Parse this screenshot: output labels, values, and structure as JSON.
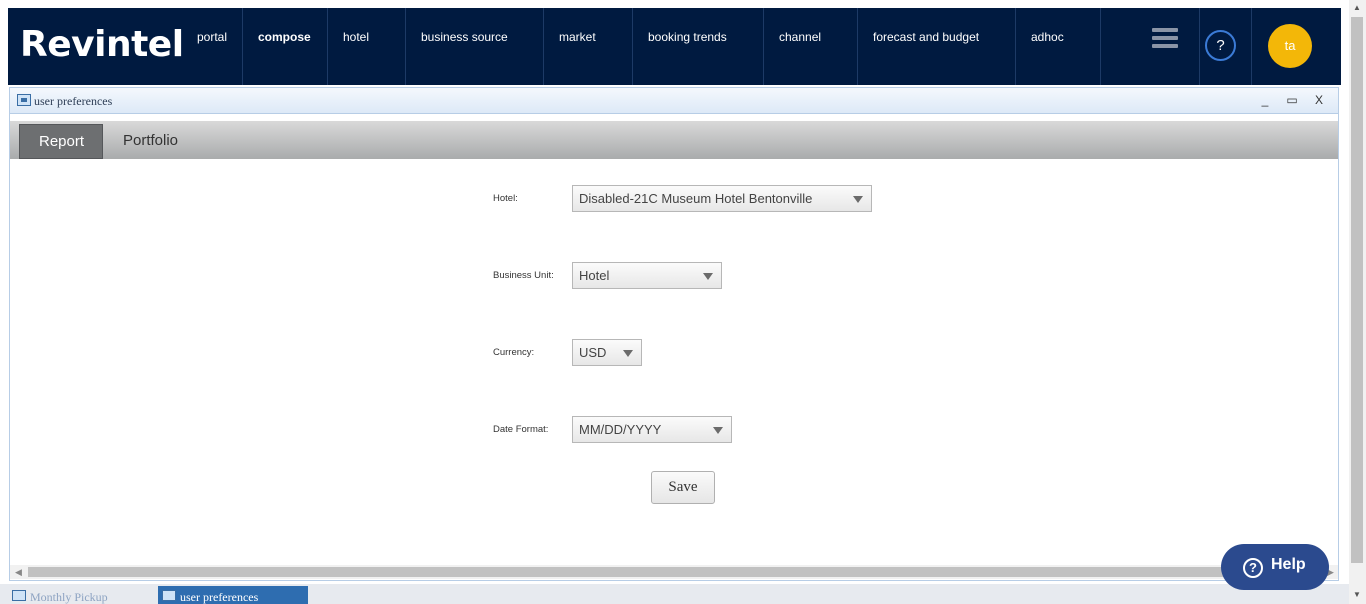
{
  "app": {
    "logo": "Revintel"
  },
  "nav": {
    "items": [
      {
        "label": "portal"
      },
      {
        "label": "compose"
      },
      {
        "label": "hotel"
      },
      {
        "label": "business source"
      },
      {
        "label": "market"
      },
      {
        "label": "booking trends"
      },
      {
        "label": "channel"
      },
      {
        "label": "forecast and budget"
      },
      {
        "label": "adhoc"
      }
    ],
    "help_label": "?",
    "avatar_initials": "ta",
    "avatar_color": "#f3b708",
    "bar_color": "#001a40"
  },
  "window": {
    "title": "user preferences",
    "minimize": "_",
    "maximize": "▭",
    "close": "X"
  },
  "tabs": [
    {
      "label": "Report",
      "active": true
    },
    {
      "label": "Portfolio",
      "active": false
    }
  ],
  "form": {
    "hotel": {
      "label": "Hotel:",
      "value": "Disabled-21C Museum Hotel Bentonville"
    },
    "business_unit": {
      "label": "Business Unit:",
      "value": "Hotel"
    },
    "currency": {
      "label": "Currency:",
      "value": "USD"
    },
    "date_format": {
      "label": "Date Format:",
      "value": "MM/DD/YYYY"
    },
    "save_label": "Save"
  },
  "taskbar": [
    {
      "label": "Monthly Pickup",
      "active": false
    },
    {
      "label": "user preferences",
      "active": true
    }
  ],
  "help_widget": {
    "label": "Help",
    "icon": "question-icon"
  }
}
